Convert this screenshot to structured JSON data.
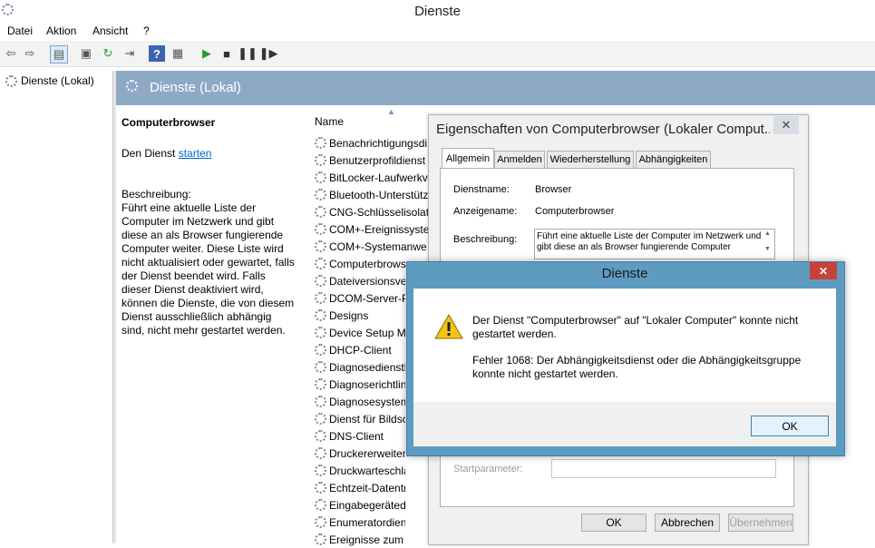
{
  "app": {
    "title": "Dienste"
  },
  "menu": [
    "Datei",
    "Aktion",
    "Ansicht",
    "?"
  ],
  "tree": {
    "root_label": "Dienste (Lokal)"
  },
  "header": {
    "title": "Dienste (Lokal)"
  },
  "details": {
    "service_name": "Computerbrowser",
    "start_prefix": "Den Dienst ",
    "start_link": "starten",
    "description_label": "Beschreibung:",
    "description_text": "Führt eine aktuelle Liste der Computer im Netzwerk und gibt diese an als Browser fungierende Computer weiter. Diese Liste wird nicht aktualisiert oder gewartet, falls der Dienst beendet wird. Falls dieser Dienst deaktiviert wird, können die Dienste, die von diesem Dienst ausschließlich abhängig sind, nicht mehr gestartet werden."
  },
  "list": {
    "column_name": "Name",
    "rows": [
      "Benachrichtigungsdi",
      "Benutzerprofildienst",
      "BitLocker-Laufwerkv",
      "Bluetooth-Unterstütz",
      "CNG-Schlüsselisolati",
      "COM+-Ereignissyste",
      "COM+-Systemanwe",
      "Computerbrows",
      "Dateiversionsver",
      "DCOM-Server-P",
      "Designs",
      "Device Setup Ma",
      "DHCP-Client",
      "Diagnosediensth",
      "Diagnoserichtlin",
      "Diagnosesystem",
      "Dienst für Bildsc",
      "DNS-Client",
      "Druckererweiterungen",
      "Druckwarteschlange",
      "Echtzeit-Datenträger",
      "Eingabegerätedienst",
      "Enumeratordienst fü",
      "Ereignisse zum Abruf"
    ]
  },
  "properties": {
    "title": "Eigenschaften von Computerbrowser (Lokaler Comput...",
    "tabs": [
      "Allgemein",
      "Anmelden",
      "Wiederherstellung",
      "Abhängigkeiten"
    ],
    "service_name_label": "Dienstname:",
    "service_name_value": "Browser",
    "display_name_label": "Anzeigename:",
    "display_name_value": "Computerbrowser",
    "description_label": "Beschreibung:",
    "description_value": "Führt eine aktuelle Liste der Computer im Netzwerk und gibt diese an als Browser fungierende Computer",
    "start_param_label": "Startparameter:",
    "buttons": {
      "ok": "OK",
      "cancel": "Abbrechen",
      "apply": "Übernehmen"
    }
  },
  "message_box": {
    "title": "Dienste",
    "line1": "Der Dienst \"Computerbrowser\" auf \"Lokaler Computer\" konnte nicht gestartet werden.",
    "line2": "Fehler 1068: Der Abhängigkeitsdienst oder die Abhängigkeitsgruppe konnte nicht gestartet werden.",
    "ok": "OK",
    "close_glyph": "✕"
  },
  "colors": {
    "header_band": "#8ea9c6",
    "dialog_frame": "#5d9cc0",
    "close_red": "#c7413a",
    "link": "#0066cc"
  }
}
